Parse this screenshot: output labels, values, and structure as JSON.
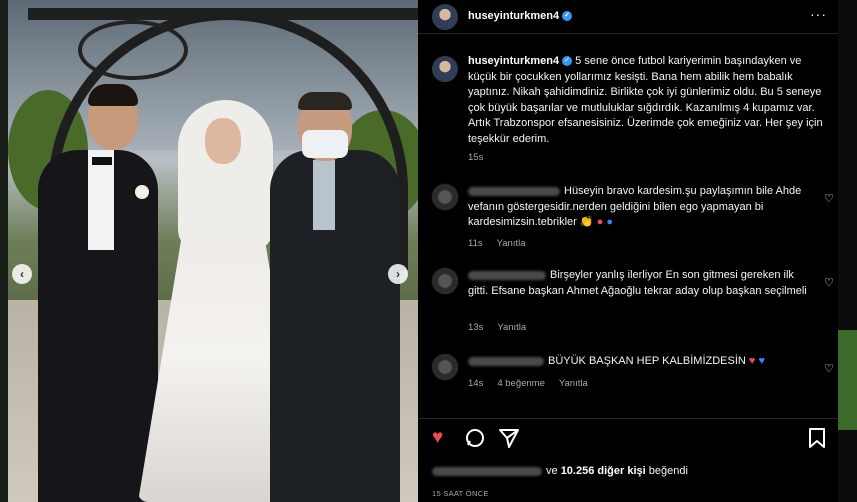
{
  "post": {
    "username": "huseyinturkmen4",
    "more_icon": "more-dots-icon",
    "caption": "5 sene önce futbol kariyerimin başındayken ve küçük bir çocukken yollarımız kesişti. Bana hem abilik hem babalık yaptınız. Nikah şahidimdiniz. Birlikte çok iyi günlerimiz oldu. Bu 5 seneye çok büyük başarılar ve mutluluklar sığdırdık. Kazanılmış 4 kupamız var. Artık Trabzonspor efsanesisiniz. Üzerimde çok emeğiniz var. Her şey için teşekkür ederim.",
    "caption_time": "15s"
  },
  "comments": [
    {
      "text": "Hüseyin bravo kardesim.şu paylaşımın bile Ahde vefanın göstergesidir.nerden geldiğini bilen ego yapmayan bi kardesimizsin.tebrikler 👏",
      "time": "11s",
      "reply": "Yanıtla",
      "likes": ""
    },
    {
      "text": "Birşeyler yanlış ilerliyor En son gitmesi gereken ilk gitti. Efsane başkan Ahmet Ağaoğlu tekrar aday olup başkan seçilmeli",
      "time": "13s",
      "reply": "Yanıtla",
      "likes": ""
    },
    {
      "text": "BÜYÜK BAŞKAN HEP KALBİMİZDESİN",
      "time": "14s",
      "reply": "Yanıtla",
      "likes": "4 beğenme"
    }
  ],
  "actions": {
    "likes_text": "ve",
    "likes_count": "10.256 diğer kişi",
    "likes_suffix": "beğendi",
    "post_time": "15 SAAT ÖNCE"
  },
  "colors": {
    "background": "#000000",
    "like_red": "#ed4956",
    "verified_blue": "#3897f0",
    "muted_text": "#a8a8a8"
  }
}
